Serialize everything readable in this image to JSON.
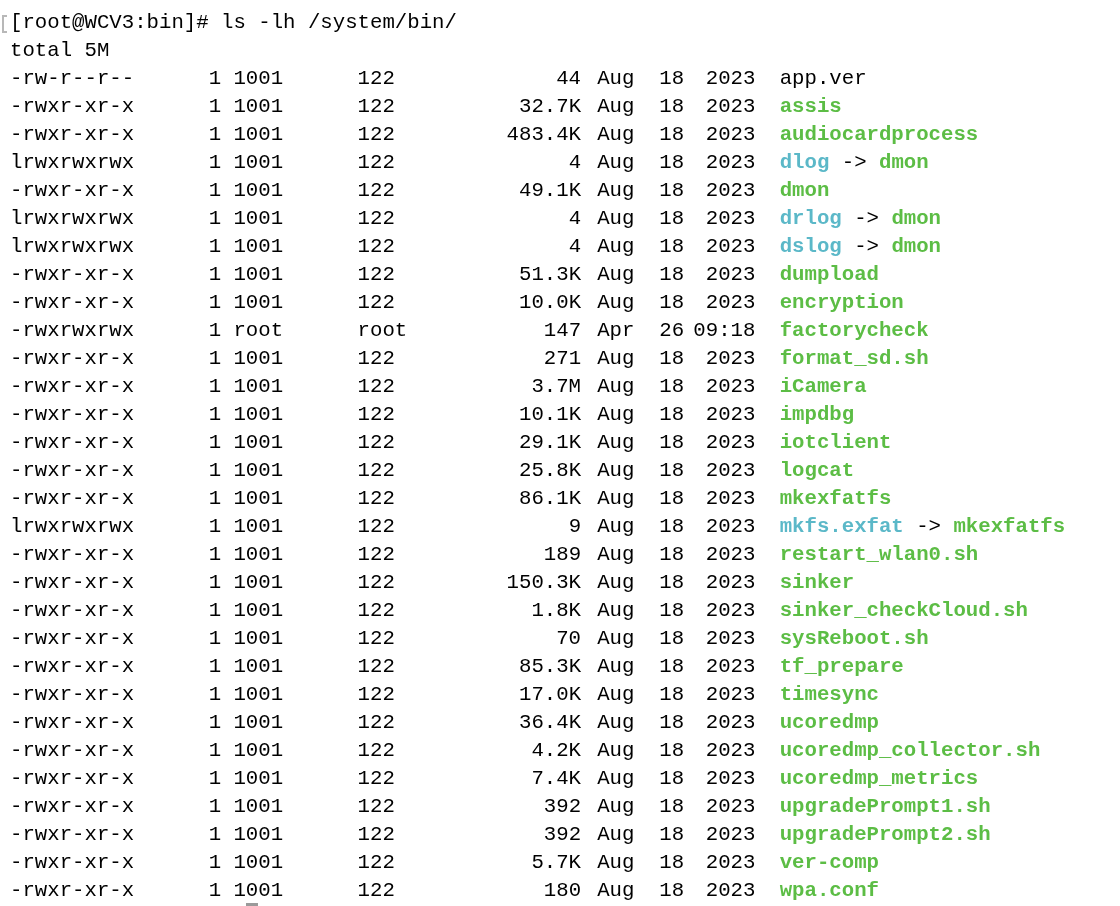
{
  "prompt": {
    "text": "[root@WCV3:bin]# ls -lh /system/bin/",
    "marked": true
  },
  "total": "total 5M",
  "rows": [
    {
      "perms": "-rw-r--r--",
      "links": "1",
      "owner": "1001",
      "group": "122",
      "size": "44",
      "month": "Aug",
      "day": "18",
      "time": "2023",
      "name": "app.ver",
      "kind": "file"
    },
    {
      "perms": "-rwxr-xr-x",
      "links": "1",
      "owner": "1001",
      "group": "122",
      "size": "32.7K",
      "month": "Aug",
      "day": "18",
      "time": "2023",
      "name": "assis",
      "kind": "exec"
    },
    {
      "perms": "-rwxr-xr-x",
      "links": "1",
      "owner": "1001",
      "group": "122",
      "size": "483.4K",
      "month": "Aug",
      "day": "18",
      "time": "2023",
      "name": "audiocardprocess",
      "kind": "exec"
    },
    {
      "perms": "lrwxrwxrwx",
      "links": "1",
      "owner": "1001",
      "group": "122",
      "size": "4",
      "month": "Aug",
      "day": "18",
      "time": "2023",
      "name": "dlog",
      "kind": "link",
      "arrow": "->",
      "target": "dmon"
    },
    {
      "perms": "-rwxr-xr-x",
      "links": "1",
      "owner": "1001",
      "group": "122",
      "size": "49.1K",
      "month": "Aug",
      "day": "18",
      "time": "2023",
      "name": "dmon",
      "kind": "exec"
    },
    {
      "perms": "lrwxrwxrwx",
      "links": "1",
      "owner": "1001",
      "group": "122",
      "size": "4",
      "month": "Aug",
      "day": "18",
      "time": "2023",
      "name": "drlog",
      "kind": "link",
      "arrow": "->",
      "target": "dmon"
    },
    {
      "perms": "lrwxrwxrwx",
      "links": "1",
      "owner": "1001",
      "group": "122",
      "size": "4",
      "month": "Aug",
      "day": "18",
      "time": "2023",
      "name": "dslog",
      "kind": "link",
      "arrow": "->",
      "target": "dmon"
    },
    {
      "perms": "-rwxr-xr-x",
      "links": "1",
      "owner": "1001",
      "group": "122",
      "size": "51.3K",
      "month": "Aug",
      "day": "18",
      "time": "2023",
      "name": "dumpload",
      "kind": "exec"
    },
    {
      "perms": "-rwxr-xr-x",
      "links": "1",
      "owner": "1001",
      "group": "122",
      "size": "10.0K",
      "month": "Aug",
      "day": "18",
      "time": "2023",
      "name": "encryption",
      "kind": "exec"
    },
    {
      "perms": "-rwxrwxrwx",
      "links": "1",
      "owner": "root",
      "group": "root",
      "size": "147",
      "month": "Apr",
      "day": "26",
      "time": "09:18",
      "name": "factorycheck",
      "kind": "exec"
    },
    {
      "perms": "-rwxr-xr-x",
      "links": "1",
      "owner": "1001",
      "group": "122",
      "size": "271",
      "month": "Aug",
      "day": "18",
      "time": "2023",
      "name": "format_sd.sh",
      "kind": "exec"
    },
    {
      "perms": "-rwxr-xr-x",
      "links": "1",
      "owner": "1001",
      "group": "122",
      "size": "3.7M",
      "month": "Aug",
      "day": "18",
      "time": "2023",
      "name": "iCamera",
      "kind": "exec"
    },
    {
      "perms": "-rwxr-xr-x",
      "links": "1",
      "owner": "1001",
      "group": "122",
      "size": "10.1K",
      "month": "Aug",
      "day": "18",
      "time": "2023",
      "name": "impdbg",
      "kind": "exec"
    },
    {
      "perms": "-rwxr-xr-x",
      "links": "1",
      "owner": "1001",
      "group": "122",
      "size": "29.1K",
      "month": "Aug",
      "day": "18",
      "time": "2023",
      "name": "iotclient",
      "kind": "exec"
    },
    {
      "perms": "-rwxr-xr-x",
      "links": "1",
      "owner": "1001",
      "group": "122",
      "size": "25.8K",
      "month": "Aug",
      "day": "18",
      "time": "2023",
      "name": "logcat",
      "kind": "exec"
    },
    {
      "perms": "-rwxr-xr-x",
      "links": "1",
      "owner": "1001",
      "group": "122",
      "size": "86.1K",
      "month": "Aug",
      "day": "18",
      "time": "2023",
      "name": "mkexfatfs",
      "kind": "exec"
    },
    {
      "perms": "lrwxrwxrwx",
      "links": "1",
      "owner": "1001",
      "group": "122",
      "size": "9",
      "month": "Aug",
      "day": "18",
      "time": "2023",
      "name": "mkfs.exfat",
      "kind": "link",
      "arrow": "->",
      "target": "mkexfatfs"
    },
    {
      "perms": "-rwxr-xr-x",
      "links": "1",
      "owner": "1001",
      "group": "122",
      "size": "189",
      "month": "Aug",
      "day": "18",
      "time": "2023",
      "name": "restart_wlan0.sh",
      "kind": "exec"
    },
    {
      "perms": "-rwxr-xr-x",
      "links": "1",
      "owner": "1001",
      "group": "122",
      "size": "150.3K",
      "month": "Aug",
      "day": "18",
      "time": "2023",
      "name": "sinker",
      "kind": "exec"
    },
    {
      "perms": "-rwxr-xr-x",
      "links": "1",
      "owner": "1001",
      "group": "122",
      "size": "1.8K",
      "month": "Aug",
      "day": "18",
      "time": "2023",
      "name": "sinker_checkCloud.sh",
      "kind": "exec"
    },
    {
      "perms": "-rwxr-xr-x",
      "links": "1",
      "owner": "1001",
      "group": "122",
      "size": "70",
      "month": "Aug",
      "day": "18",
      "time": "2023",
      "name": "sysReboot.sh",
      "kind": "exec"
    },
    {
      "perms": "-rwxr-xr-x",
      "links": "1",
      "owner": "1001",
      "group": "122",
      "size": "85.3K",
      "month": "Aug",
      "day": "18",
      "time": "2023",
      "name": "tf_prepare",
      "kind": "exec"
    },
    {
      "perms": "-rwxr-xr-x",
      "links": "1",
      "owner": "1001",
      "group": "122",
      "size": "17.0K",
      "month": "Aug",
      "day": "18",
      "time": "2023",
      "name": "timesync",
      "kind": "exec"
    },
    {
      "perms": "-rwxr-xr-x",
      "links": "1",
      "owner": "1001",
      "group": "122",
      "size": "36.4K",
      "month": "Aug",
      "day": "18",
      "time": "2023",
      "name": "ucoredmp",
      "kind": "exec"
    },
    {
      "perms": "-rwxr-xr-x",
      "links": "1",
      "owner": "1001",
      "group": "122",
      "size": "4.2K",
      "month": "Aug",
      "day": "18",
      "time": "2023",
      "name": "ucoredmp_collector.sh",
      "kind": "exec"
    },
    {
      "perms": "-rwxr-xr-x",
      "links": "1",
      "owner": "1001",
      "group": "122",
      "size": "7.4K",
      "month": "Aug",
      "day": "18",
      "time": "2023",
      "name": "ucoredmp_metrics",
      "kind": "exec"
    },
    {
      "perms": "-rwxr-xr-x",
      "links": "1",
      "owner": "1001",
      "group": "122",
      "size": "392",
      "month": "Aug",
      "day": "18",
      "time": "2023",
      "name": "upgradePrompt1.sh",
      "kind": "exec"
    },
    {
      "perms": "-rwxr-xr-x",
      "links": "1",
      "owner": "1001",
      "group": "122",
      "size": "392",
      "month": "Aug",
      "day": "18",
      "time": "2023",
      "name": "upgradePrompt2.sh",
      "kind": "exec"
    },
    {
      "perms": "-rwxr-xr-x",
      "links": "1",
      "owner": "1001",
      "group": "122",
      "size": "5.7K",
      "month": "Aug",
      "day": "18",
      "time": "2023",
      "name": "ver-comp",
      "kind": "exec"
    },
    {
      "perms": "-rwxr-xr-x",
      "links": "1",
      "owner": "1001",
      "group": "122",
      "size": "180",
      "month": "Aug",
      "day": "18",
      "time": "2023",
      "name": "wpa.conf",
      "kind": "exec",
      "cursor": true
    }
  ]
}
